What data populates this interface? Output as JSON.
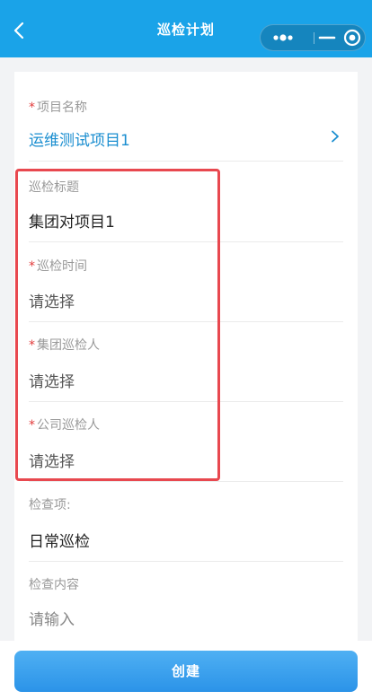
{
  "nav": {
    "title": "巡检计划",
    "icons": {
      "back": "back-arrow-icon",
      "more": "more-dots-icon",
      "minimize": "minimize-icon",
      "close": "close-circle-icon"
    }
  },
  "form": {
    "fields": [
      {
        "key": "project_name",
        "required": true,
        "label": "项目名称",
        "value": "运维测试项目1",
        "style": "link",
        "has_chevron": true
      },
      {
        "key": "inspection_title",
        "required": false,
        "label": "巡检标题",
        "value": "集团对项目1",
        "style": "normal"
      },
      {
        "key": "inspection_time",
        "required": true,
        "label": "巡检时间",
        "value": "请选择",
        "style": "placeholder"
      },
      {
        "key": "group_inspector",
        "required": true,
        "label": "集团巡检人",
        "value": "请选择",
        "style": "placeholder"
      },
      {
        "key": "company_inspector",
        "required": true,
        "label": "公司巡检人",
        "value": "请选择",
        "style": "placeholder"
      },
      {
        "key": "check_item",
        "required": false,
        "label": "检查项:",
        "value": "日常巡检",
        "style": "normal"
      },
      {
        "key": "check_content",
        "required": false,
        "label": "检查内容",
        "placeholder": "请输入",
        "style": "input"
      }
    ],
    "required_mark": "*"
  },
  "actions": {
    "create_label": "创建"
  },
  "colors": {
    "nav_bg": "#1aa3e8",
    "link": "#1a8ed0",
    "required": "#e23c3c",
    "highlight": "#e8484f"
  }
}
